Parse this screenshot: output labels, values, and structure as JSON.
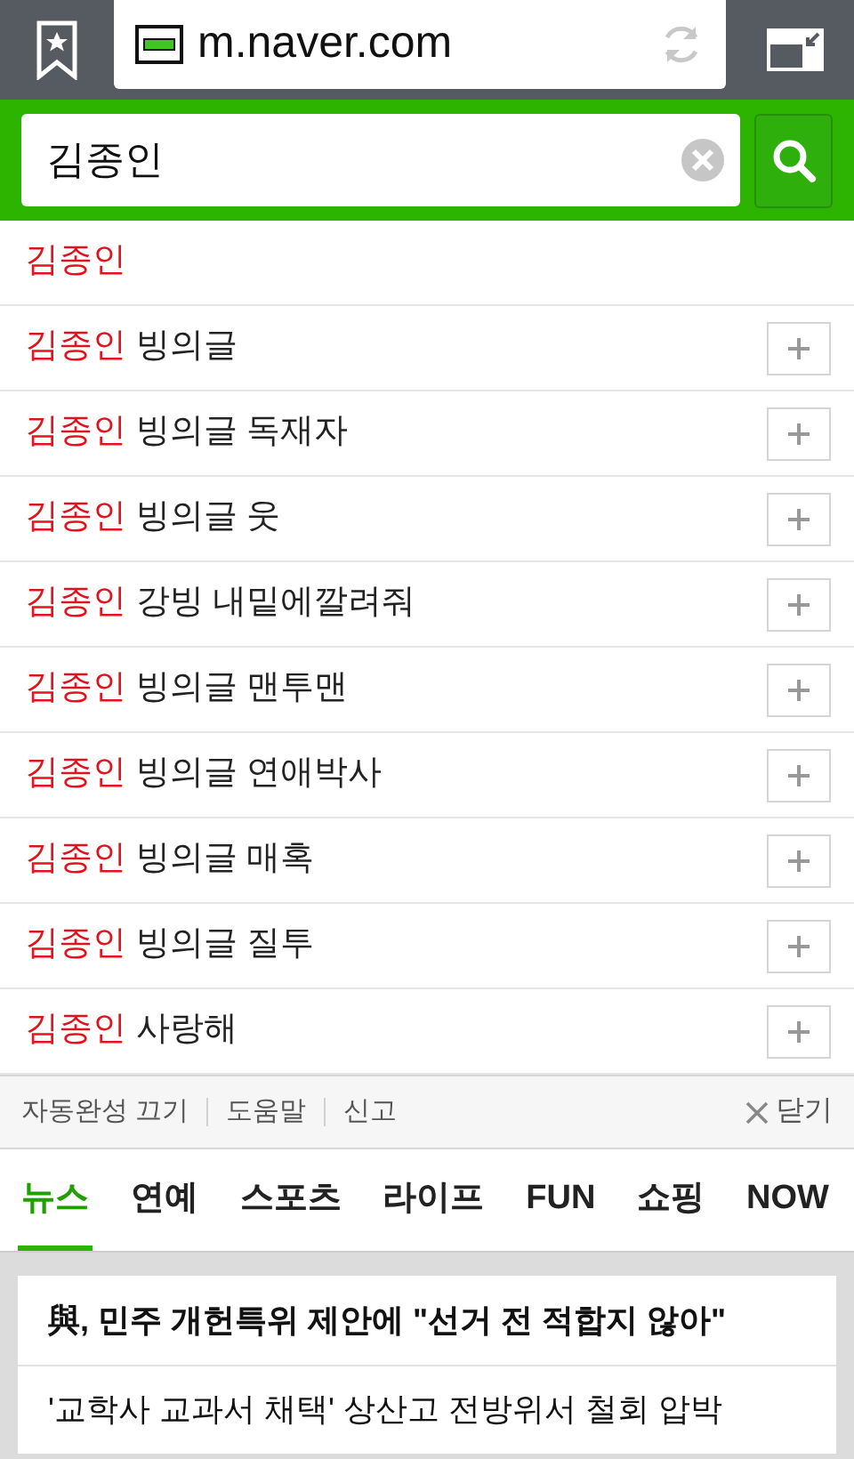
{
  "browser": {
    "url": "m.naver.com"
  },
  "search": {
    "value": "김종인"
  },
  "suggestions": [
    {
      "match": "김종인",
      "kind": "plain"
    },
    {
      "match": "김종인",
      "rest": "빙의글",
      "kind": "expandable"
    },
    {
      "match": "김종인",
      "rest": "빙의글 독재자",
      "kind": "expandable"
    },
    {
      "match": "김종인",
      "rest": "빙의글 웃",
      "kind": "expandable"
    },
    {
      "match": "김종인",
      "rest": "강빙 내밑에깔려줘",
      "kind": "expandable"
    },
    {
      "match": "김종인",
      "rest": "빙의글 맨투맨",
      "kind": "expandable"
    },
    {
      "match": "김종인",
      "rest": "빙의글 연애박사",
      "kind": "expandable"
    },
    {
      "match": "김종인",
      "rest": "빙의글 매혹",
      "kind": "expandable"
    },
    {
      "match": "김종인",
      "rest": "빙의글 질투",
      "kind": "expandable"
    },
    {
      "match": "김종인",
      "rest": "사랑해",
      "kind": "expandable"
    }
  ],
  "footer": {
    "links": [
      "자동완성 끄기",
      "도움말",
      "신고"
    ],
    "close": "닫기"
  },
  "tabs": [
    {
      "label": "뉴스",
      "selected": true
    },
    {
      "label": "연예",
      "selected": false
    },
    {
      "label": "스포츠",
      "selected": false
    },
    {
      "label": "라이프",
      "selected": false
    },
    {
      "label": "FUN",
      "selected": false
    },
    {
      "label": "쇼핑",
      "selected": false
    },
    {
      "label": "NOW",
      "selected": false
    }
  ],
  "news": [
    {
      "title": "與, 민주 개헌특위 제안에 \"선거 전 적합지 않아\"",
      "headline": true
    },
    {
      "title": "'교학사 교과서 채택' 상산고 전방위서 철회 압박",
      "headline": false
    }
  ]
}
